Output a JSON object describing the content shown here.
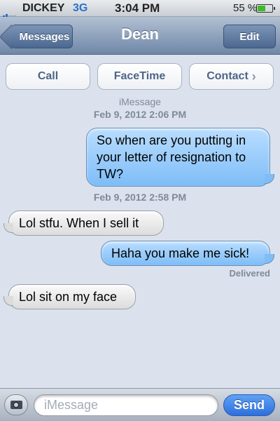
{
  "status_bar": {
    "carrier": "DICKEY",
    "network": "3G",
    "time": "3:04 PM",
    "battery_percent": "55 %",
    "battery_level": 0.55,
    "signal_bars": 2
  },
  "nav": {
    "back_label": "Messages",
    "title": "Dean",
    "edit_label": "Edit"
  },
  "actions": {
    "call_label": "Call",
    "facetime_label": "FaceTime",
    "contact_label": "Contact"
  },
  "conversation": {
    "service": "iMessage",
    "timestamps": [
      "Feb 9, 2012 2:06 PM",
      "Feb 9, 2012 2:58 PM"
    ],
    "messages": [
      {
        "direction": "outgoing",
        "text": "So when are you putting in your letter of resignation to TW?"
      },
      {
        "direction": "incoming",
        "text": "Lol stfu. When I sell it"
      },
      {
        "direction": "outgoing",
        "text": "Haha you make me sick!"
      },
      {
        "direction": "incoming",
        "text": "Lol sit on my face"
      }
    ],
    "delivered_label": "Delivered"
  },
  "input_bar": {
    "camera_icon": "camera-icon",
    "placeholder": "iMessage",
    "value": "",
    "send_label": "Send"
  },
  "colors": {
    "outgoing_bubble": "#7ebdf7",
    "incoming_bubble": "#dcdcdc",
    "background": "#dbe2ed",
    "send_button": "#2d6fdc"
  }
}
